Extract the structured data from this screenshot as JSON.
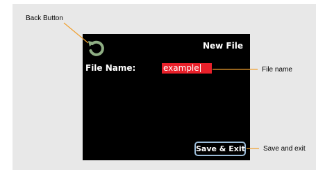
{
  "screen": {
    "title": "New File",
    "field_label": "File Name:",
    "field_value": "example",
    "save_label": "Save & Exit",
    "back_icon": "refresh-icon",
    "colors": {
      "screen_bg": "#000000",
      "input_bg": "#e8202a",
      "save_border": "#9bbcd8",
      "back_icon": "#8fae84",
      "callout_line": "#f0a030"
    }
  },
  "callouts": {
    "back": "Back Button",
    "file_name": "File name",
    "save": "Save and exit"
  }
}
